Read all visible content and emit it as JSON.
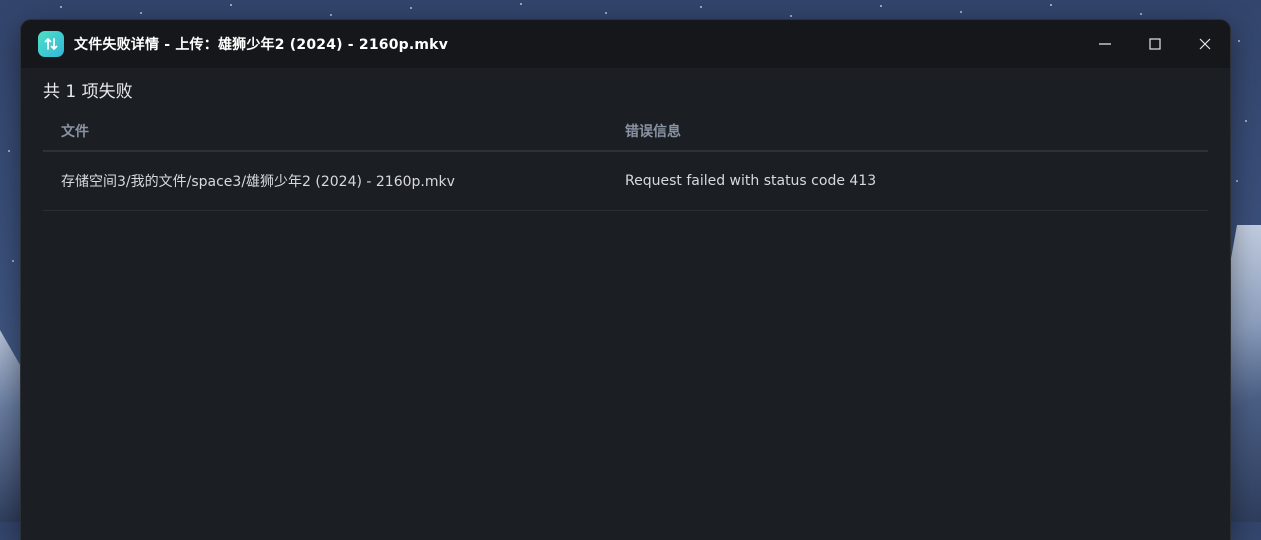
{
  "window": {
    "title": "文件失败详情 - 上传：雄狮少年2 (2024) - 2160p.mkv",
    "app_icon": "upload-download-arrows-icon",
    "controls": [
      "minimize-icon",
      "maximize-icon",
      "close-icon"
    ]
  },
  "summary": "共 1 项失败",
  "table": {
    "headers": [
      "文件",
      "错误信息"
    ],
    "rows": [
      {
        "file": "存储空间3/我的文件/space3/雄狮少年2 (2024) - 2160p.mkv",
        "error": "Request failed with status code 413"
      }
    ]
  },
  "colors": {
    "window_bg": "#1b1e23",
    "titlebar_bg": "#15171a",
    "accent": "#3fcfcf",
    "header_text": "#8a93a3"
  }
}
